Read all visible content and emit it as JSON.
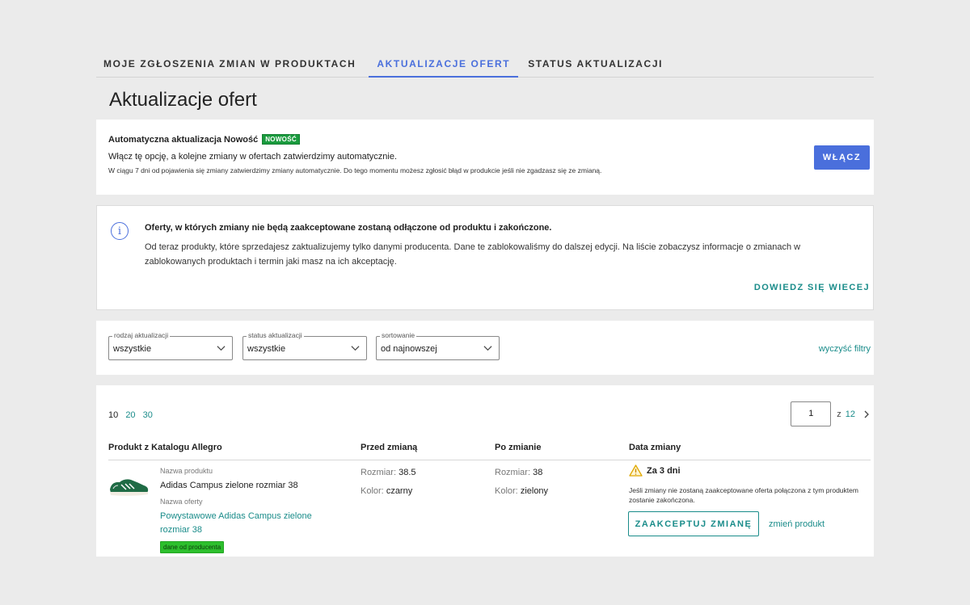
{
  "tabs": [
    {
      "label": "MOJE ZGŁOSZENIA ZMIAN W PRODUKTACH"
    },
    {
      "label": "AKTUALIZACJE OFERT"
    },
    {
      "label": "STATUS AKTUALIZACJI"
    }
  ],
  "page_title": "Aktualizacje ofert",
  "auto_update": {
    "title": "Automatyczna aktualizacja Nowość",
    "badge": "NOWOŚĆ",
    "description": "Włącz tę opcję, a kolejne zmiany w ofertach zatwierdzimy automatycznie.",
    "note": "W ciągu 7 dni od pojawienia się zmiany zatwierdzimy zmiany automatycznie. Do tego momentu możesz zgłosić błąd w produkcie jeśli nie zgadzasz się ze zmianą.",
    "button": "WŁĄCZ"
  },
  "info": {
    "icon": "info-icon",
    "title": "Oferty, w których zmiany nie będą zaakceptowane zostaną odłączone od produktu i zakończone.",
    "body": "Od teraz produkty, które sprzedajesz zaktualizujemy tylko danymi producenta. Dane te zablokowaliśmy do dalszej edycji. Na liście zobaczysz informacje o zmianach w zablokowanych produktach i termin jaki masz na ich akceptację.",
    "link": "DOWIEDZ SIĘ WIECEJ"
  },
  "filters": {
    "type": {
      "label": "rodzaj aktualizacji",
      "value": "wszystkie"
    },
    "status": {
      "label": "status aktualizacji",
      "value": "wszystkie"
    },
    "sort": {
      "label": "sortowanie",
      "value": "od najnowszej"
    },
    "clear": "wyczyść filtry"
  },
  "pagination": {
    "per_page": [
      "10",
      "20",
      "30"
    ],
    "current_page": "1",
    "of": "z",
    "total_pages": "12"
  },
  "table": {
    "headers": [
      "Produkt z Katalogu Allegro",
      "Przed zmianą",
      "Po zmianie",
      "Data zmiany"
    ],
    "rows": [
      {
        "product_label": "Nazwa produktu",
        "product_name": "Adidas Campus zielone rozmiar 38",
        "offer_label": "Nazwa oferty",
        "offer_name": "Powystawowe Adidas Campus zielone rozmiar 38",
        "source_badge": "dane od producenta",
        "before": {
          "size_key": "Rozmiar:",
          "size_val": "38.5",
          "color_key": "Kolor:",
          "color_val": "czarny"
        },
        "after": {
          "size_key": "Rozmiar:",
          "size_val": "38",
          "color_key": "Kolor:",
          "color_val": "zielony"
        },
        "deadline": "Za 3 dni",
        "deadline_note": "Jeśli zmiany nie zostaną zaakceptowane oferta połączona z tym produktem zostanie zakończona.",
        "accept_button": "ZAAKCEPTUJ ZMIANĘ",
        "change_link": "zmień produkt"
      }
    ]
  },
  "colors": {
    "accent": "#4a6fdc",
    "link": "#1a8c8a",
    "new_badge": "#1a9b3e",
    "warning": "#f2b700"
  }
}
